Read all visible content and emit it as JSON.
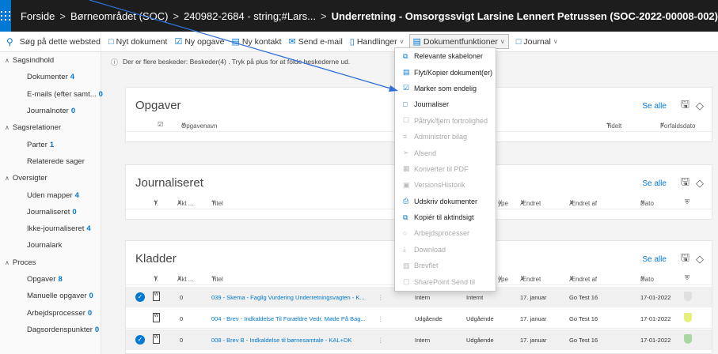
{
  "breadcrumb": [
    "Forside",
    "Børneområdet (SOC)",
    "240982-2684 - string;#Lars...",
    "Underretning - Omsorgssvigt Larsine Lennert Petrussen (SOC-2022-00008-002)"
  ],
  "commandbar": {
    "search": "Søg på dette websted",
    "new_document": "Nyt dokument",
    "new_task": "Ny opgave",
    "new_contact": "Ny kontakt",
    "send_email": "Send e-mail",
    "actions": "Handlinger",
    "document_functions": "Dokumentfunktioner",
    "journal": "Journal"
  },
  "sidebar": {
    "items": [
      {
        "label": "Sagsindhold",
        "type": "head",
        "count": ""
      },
      {
        "label": "Dokumenter",
        "type": "item",
        "count": "4"
      },
      {
        "label": "E-mails (efter samt...",
        "type": "item",
        "count": "0"
      },
      {
        "label": "Journalnoter",
        "type": "item",
        "count": "0"
      },
      {
        "label": "Sagsrelationer",
        "type": "head",
        "count": ""
      },
      {
        "label": "Parter",
        "type": "item",
        "count": "1"
      },
      {
        "label": "Relaterede sager",
        "type": "item",
        "count": ""
      },
      {
        "label": "Oversigter",
        "type": "head",
        "count": ""
      },
      {
        "label": "Uden mapper",
        "type": "item",
        "count": "4"
      },
      {
        "label": "Journaliseret",
        "type": "item",
        "count": "0"
      },
      {
        "label": "Ikke-journaliseret",
        "type": "item",
        "count": "4"
      },
      {
        "label": "Journalark",
        "type": "item",
        "count": ""
      },
      {
        "label": "Proces",
        "type": "head",
        "count": ""
      },
      {
        "label": "Opgaver",
        "type": "item",
        "count": "8"
      },
      {
        "label": "Manuelle opgaver",
        "type": "item",
        "count": "0"
      },
      {
        "label": "Arbejdsprocesser",
        "type": "item",
        "count": "0"
      },
      {
        "label": "Dagsordenspunkter",
        "type": "item",
        "count": "0"
      }
    ]
  },
  "notice": "Der er flere beskeder: Beskeder(4) . Tryk på plus for at folde beskederne ud.",
  "opgaver": {
    "title": "Opgaver",
    "see_all": "Se alle",
    "col_name": "Opgavenavn",
    "col_time": "Tidelt",
    "col_due": "Forfaldsdato"
  },
  "journaliseret": {
    "title": "Journaliseret",
    "see_all": "Se alle",
    "cols": [
      "T.",
      "Akt ...",
      "Titel",
      "ype",
      "Ændret",
      "Ændret af",
      "Dato"
    ]
  },
  "kladder": {
    "title": "Kladder",
    "see_all": "Se alle",
    "cols": [
      "T.",
      "Akt ...",
      "Titel",
      "ype",
      "Ændret",
      "Ændret af",
      "Dato"
    ],
    "rows": [
      {
        "akt": "0",
        "title": "039 - Skema - Faglig Vurdering Underretningsvagten - K...",
        "type": "Intern",
        "type2": "Internt",
        "changed": "17. januar",
        "by": "Go Test 16",
        "date": "17-01-2022"
      },
      {
        "akt": "0",
        "title": "004 - Brev - Indkaldelse Til Forældre Vedr. Møde På Bag...",
        "type": "Udgående",
        "type2": "Udgående",
        "changed": "17. januar",
        "by": "Go Test 16",
        "date": "17-01-2022"
      },
      {
        "akt": "0",
        "title": "008 - Brev B - Indkaldelse til børnesamtale - KAL+DK",
        "type": "Intern",
        "type2": "Udgående",
        "changed": "17. januar",
        "by": "Go Test 16",
        "date": "17-01-2022"
      }
    ]
  },
  "dropdown": {
    "items": [
      {
        "label": "Relevante skabeloner",
        "disabled": false
      },
      {
        "label": "Flyt/Kopier dokument(er)",
        "disabled": false
      },
      {
        "label": "Marker som endelig",
        "disabled": false
      },
      {
        "label": "Journaliser",
        "disabled": false
      },
      {
        "label": "Påtryk/fjern fortrolighed",
        "disabled": true
      },
      {
        "label": "Administrer bilag",
        "disabled": true
      },
      {
        "label": "Afsend",
        "disabled": true
      },
      {
        "label": "Konverter til PDF",
        "disabled": true
      },
      {
        "label": "VersionsHistorik",
        "disabled": true
      },
      {
        "label": "Udskriv dokumenter",
        "disabled": false
      },
      {
        "label": "Kopiér til aktindsigt",
        "disabled": false
      },
      {
        "label": "Arbejdsprocesser",
        "disabled": true
      },
      {
        "label": "Download",
        "disabled": true
      },
      {
        "label": "Brevflet",
        "disabled": true
      },
      {
        "label": "SharePoint Send til",
        "disabled": true
      }
    ]
  },
  "colors": {
    "accent": "#0078d4",
    "topbar": "#1d1d1d"
  }
}
